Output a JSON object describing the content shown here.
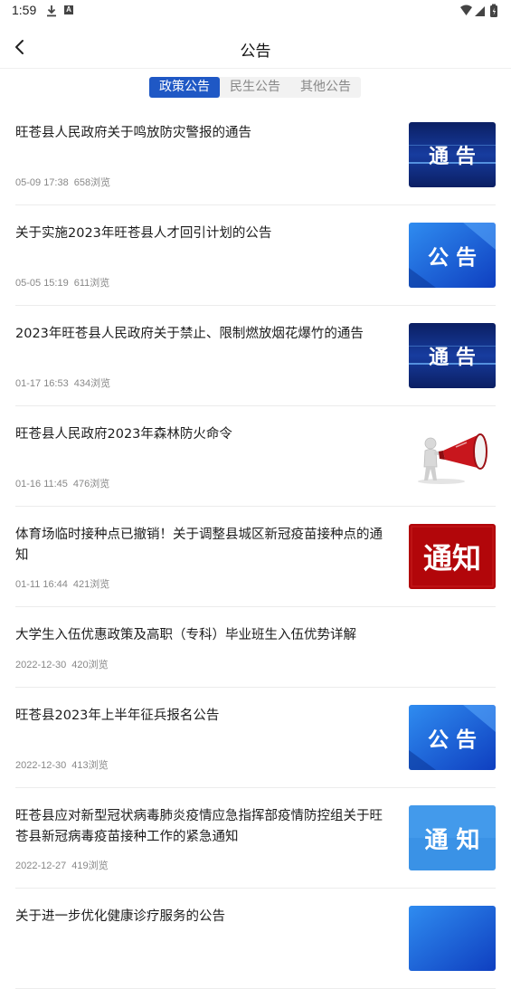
{
  "status_bar": {
    "time": "1:59",
    "a_badge": "A"
  },
  "header": {
    "title": "公告"
  },
  "tabs": [
    {
      "label": "政策公告",
      "active": true
    },
    {
      "label": "民生公告",
      "active": false
    },
    {
      "label": "其他公告",
      "active": false
    }
  ],
  "items": [
    {
      "title": "旺苍县人民政府关于鸣放防灾警报的通告",
      "date": "05-09 17:38",
      "views": "658浏览",
      "thumb_text": "通 告"
    },
    {
      "title": "关于实施2023年旺苍县人才回引计划的公告",
      "date": "05-05 15:19",
      "views": "611浏览",
      "thumb_text": "公 告"
    },
    {
      "title": "2023年旺苍县人民政府关于禁止、限制燃放烟花爆竹的通告",
      "date": "01-17 16:53",
      "views": "434浏览",
      "thumb_text": "通 告"
    },
    {
      "title": "旺苍县人民政府2023年森林防火命令",
      "date": "01-16 11:45",
      "views": "476浏览"
    },
    {
      "title": "体育场临时接种点已撤销！关于调整县城区新冠疫苗接种点的通知",
      "date": "01-11 16:44",
      "views": "421浏览",
      "thumb_text": "通知"
    },
    {
      "title": "大学生入伍优惠政策及高职（专科）毕业班生入伍优势详解",
      "date": "2022-12-30",
      "views": "420浏览"
    },
    {
      "title": "旺苍县2023年上半年征兵报名公告",
      "date": "2022-12-30",
      "views": "413浏览",
      "thumb_text": "公 告"
    },
    {
      "title": "旺苍县应对新型冠状病毒肺炎疫情应急指挥部疫情防控组关于旺苍县新冠病毒疫苗接种工作的紧急通知",
      "date": "2022-12-27",
      "views": "419浏览",
      "thumb_text": "通 知"
    },
    {
      "title": "关于进一步优化健康诊疗服务的公告"
    }
  ],
  "colors": {
    "accent": "#1f58c5",
    "meta": "#888888",
    "divider": "#ececec"
  }
}
